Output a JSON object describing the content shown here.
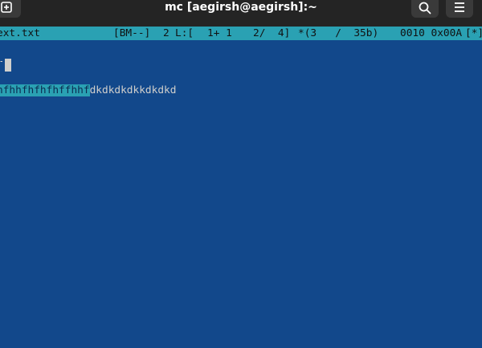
{
  "window": {
    "title": "mc [aegirsh@aegirsh]:~"
  },
  "toolbar": {
    "new_tab_icon": "new-tab-plus-icon",
    "search_icon": "search-icon",
    "menu_icon": "hamburger-menu-icon"
  },
  "status": {
    "filename": "ext.txt",
    "mode": "[BM--]",
    "col": "2",
    "line_label": "L:[",
    "line_pos": "1+ 1",
    "line_of": "2/  4]",
    "char_info": "*(3   /  35b)",
    "char_code": "0010 0x00A",
    "modified": "[*]"
  },
  "editor": {
    "line1_partial": "+",
    "line3_selected": "hfhhfhfhfhffhhf",
    "line3_rest": "dkdkdkdkkdkdkd"
  },
  "colors": {
    "background": "#12488b",
    "status_bar": "#2aa1b3",
    "titlebar": "#242424",
    "text": "#d0cfcc"
  }
}
